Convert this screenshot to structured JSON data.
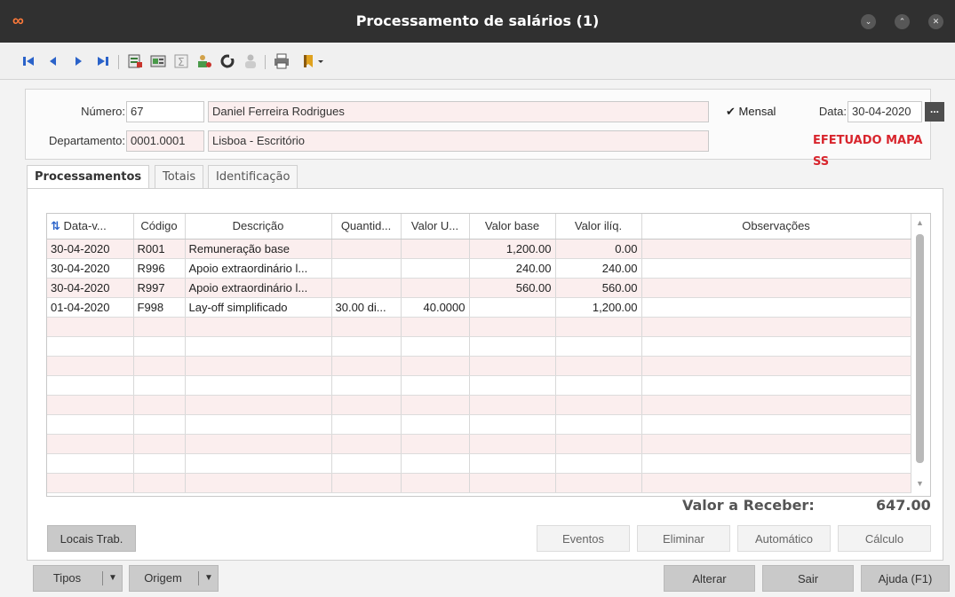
{
  "window": {
    "title": "Processamento de salários (1)"
  },
  "header": {
    "numero_label": "Número:",
    "numero_value": "67",
    "employee_name": "Daniel Ferreira Rodrigues",
    "mensal_label": "Mensal",
    "data_label": "Data:",
    "data_value": "30-04-2020",
    "ellipsis": "...",
    "departamento_label": "Departamento:",
    "departamento_value": "0001.0001",
    "departamento_name": "Lisboa - Escritório",
    "status": "EFETUADO MAPA SS"
  },
  "tabs": [
    "Processamentos",
    "Totais",
    "Identificação"
  ],
  "grid": {
    "columns": [
      "Data-v...",
      "Código",
      "Descrição",
      "Quantid...",
      "Valor U...",
      "Valor base",
      "Valor ilíq.",
      "Observações"
    ],
    "rows": [
      [
        "30-04-2020",
        "R001",
        "Remuneração base",
        "",
        "",
        "1,200.00",
        "0.00",
        ""
      ],
      [
        "30-04-2020",
        "R996",
        "Apoio extraordinário l...",
        "",
        "",
        "240.00",
        "240.00",
        ""
      ],
      [
        "30-04-2020",
        "R997",
        "Apoio extraordinário l...",
        "",
        "",
        "560.00",
        "560.00",
        ""
      ],
      [
        "01-04-2020",
        "F998",
        "Lay-off simplificado",
        "30.00 di...",
        "40.0000",
        "",
        "1,200.00",
        ""
      ]
    ]
  },
  "totals": {
    "label": "Valor a Receber:",
    "value": "647.00"
  },
  "buttons": {
    "locais": "Locais Trab.",
    "eventos": "Eventos",
    "eliminar": "Eliminar",
    "automatico": "Automático",
    "calculo": "Cálculo",
    "tipos": "Tipos",
    "origem": "Origem",
    "alterar": "Alterar",
    "sair": "Sair",
    "ajuda": "Ajuda (F1)"
  },
  "colors": {
    "accent_red": "#d8252d",
    "title_bar": "#303030",
    "row_pink": "#fbeeee"
  }
}
